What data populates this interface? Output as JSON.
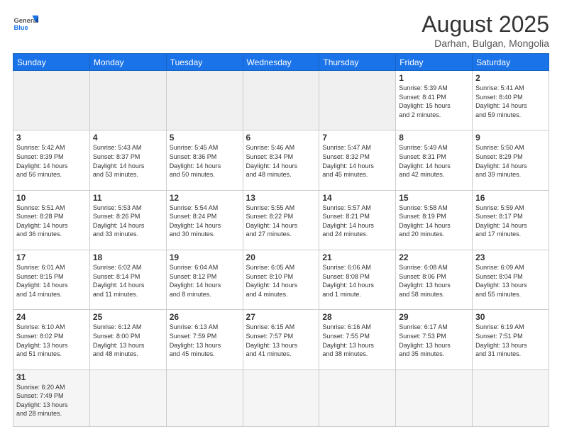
{
  "header": {
    "logo_general": "General",
    "logo_blue": "Blue",
    "month_title": "August 2025",
    "location": "Darhan, Bulgan, Mongolia"
  },
  "weekdays": [
    "Sunday",
    "Monday",
    "Tuesday",
    "Wednesday",
    "Thursday",
    "Friday",
    "Saturday"
  ],
  "weeks": [
    [
      {
        "day": "",
        "info": ""
      },
      {
        "day": "",
        "info": ""
      },
      {
        "day": "",
        "info": ""
      },
      {
        "day": "",
        "info": ""
      },
      {
        "day": "",
        "info": ""
      },
      {
        "day": "1",
        "info": "Sunrise: 5:39 AM\nSunset: 8:41 PM\nDaylight: 15 hours\nand 2 minutes."
      },
      {
        "day": "2",
        "info": "Sunrise: 5:41 AM\nSunset: 8:40 PM\nDaylight: 14 hours\nand 59 minutes."
      }
    ],
    [
      {
        "day": "3",
        "info": "Sunrise: 5:42 AM\nSunset: 8:39 PM\nDaylight: 14 hours\nand 56 minutes."
      },
      {
        "day": "4",
        "info": "Sunrise: 5:43 AM\nSunset: 8:37 PM\nDaylight: 14 hours\nand 53 minutes."
      },
      {
        "day": "5",
        "info": "Sunrise: 5:45 AM\nSunset: 8:36 PM\nDaylight: 14 hours\nand 50 minutes."
      },
      {
        "day": "6",
        "info": "Sunrise: 5:46 AM\nSunset: 8:34 PM\nDaylight: 14 hours\nand 48 minutes."
      },
      {
        "day": "7",
        "info": "Sunrise: 5:47 AM\nSunset: 8:32 PM\nDaylight: 14 hours\nand 45 minutes."
      },
      {
        "day": "8",
        "info": "Sunrise: 5:49 AM\nSunset: 8:31 PM\nDaylight: 14 hours\nand 42 minutes."
      },
      {
        "day": "9",
        "info": "Sunrise: 5:50 AM\nSunset: 8:29 PM\nDaylight: 14 hours\nand 39 minutes."
      }
    ],
    [
      {
        "day": "10",
        "info": "Sunrise: 5:51 AM\nSunset: 8:28 PM\nDaylight: 14 hours\nand 36 minutes."
      },
      {
        "day": "11",
        "info": "Sunrise: 5:53 AM\nSunset: 8:26 PM\nDaylight: 14 hours\nand 33 minutes."
      },
      {
        "day": "12",
        "info": "Sunrise: 5:54 AM\nSunset: 8:24 PM\nDaylight: 14 hours\nand 30 minutes."
      },
      {
        "day": "13",
        "info": "Sunrise: 5:55 AM\nSunset: 8:22 PM\nDaylight: 14 hours\nand 27 minutes."
      },
      {
        "day": "14",
        "info": "Sunrise: 5:57 AM\nSunset: 8:21 PM\nDaylight: 14 hours\nand 24 minutes."
      },
      {
        "day": "15",
        "info": "Sunrise: 5:58 AM\nSunset: 8:19 PM\nDaylight: 14 hours\nand 20 minutes."
      },
      {
        "day": "16",
        "info": "Sunrise: 5:59 AM\nSunset: 8:17 PM\nDaylight: 14 hours\nand 17 minutes."
      }
    ],
    [
      {
        "day": "17",
        "info": "Sunrise: 6:01 AM\nSunset: 8:15 PM\nDaylight: 14 hours\nand 14 minutes."
      },
      {
        "day": "18",
        "info": "Sunrise: 6:02 AM\nSunset: 8:14 PM\nDaylight: 14 hours\nand 11 minutes."
      },
      {
        "day": "19",
        "info": "Sunrise: 6:04 AM\nSunset: 8:12 PM\nDaylight: 14 hours\nand 8 minutes."
      },
      {
        "day": "20",
        "info": "Sunrise: 6:05 AM\nSunset: 8:10 PM\nDaylight: 14 hours\nand 4 minutes."
      },
      {
        "day": "21",
        "info": "Sunrise: 6:06 AM\nSunset: 8:08 PM\nDaylight: 14 hours\nand 1 minute."
      },
      {
        "day": "22",
        "info": "Sunrise: 6:08 AM\nSunset: 8:06 PM\nDaylight: 13 hours\nand 58 minutes."
      },
      {
        "day": "23",
        "info": "Sunrise: 6:09 AM\nSunset: 8:04 PM\nDaylight: 13 hours\nand 55 minutes."
      }
    ],
    [
      {
        "day": "24",
        "info": "Sunrise: 6:10 AM\nSunset: 8:02 PM\nDaylight: 13 hours\nand 51 minutes."
      },
      {
        "day": "25",
        "info": "Sunrise: 6:12 AM\nSunset: 8:00 PM\nDaylight: 13 hours\nand 48 minutes."
      },
      {
        "day": "26",
        "info": "Sunrise: 6:13 AM\nSunset: 7:59 PM\nDaylight: 13 hours\nand 45 minutes."
      },
      {
        "day": "27",
        "info": "Sunrise: 6:15 AM\nSunset: 7:57 PM\nDaylight: 13 hours\nand 41 minutes."
      },
      {
        "day": "28",
        "info": "Sunrise: 6:16 AM\nSunset: 7:55 PM\nDaylight: 13 hours\nand 38 minutes."
      },
      {
        "day": "29",
        "info": "Sunrise: 6:17 AM\nSunset: 7:53 PM\nDaylight: 13 hours\nand 35 minutes."
      },
      {
        "day": "30",
        "info": "Sunrise: 6:19 AM\nSunset: 7:51 PM\nDaylight: 13 hours\nand 31 minutes."
      }
    ],
    [
      {
        "day": "31",
        "info": "Sunrise: 6:20 AM\nSunset: 7:49 PM\nDaylight: 13 hours\nand 28 minutes."
      },
      {
        "day": "",
        "info": ""
      },
      {
        "day": "",
        "info": ""
      },
      {
        "day": "",
        "info": ""
      },
      {
        "day": "",
        "info": ""
      },
      {
        "day": "",
        "info": ""
      },
      {
        "day": "",
        "info": ""
      }
    ]
  ]
}
